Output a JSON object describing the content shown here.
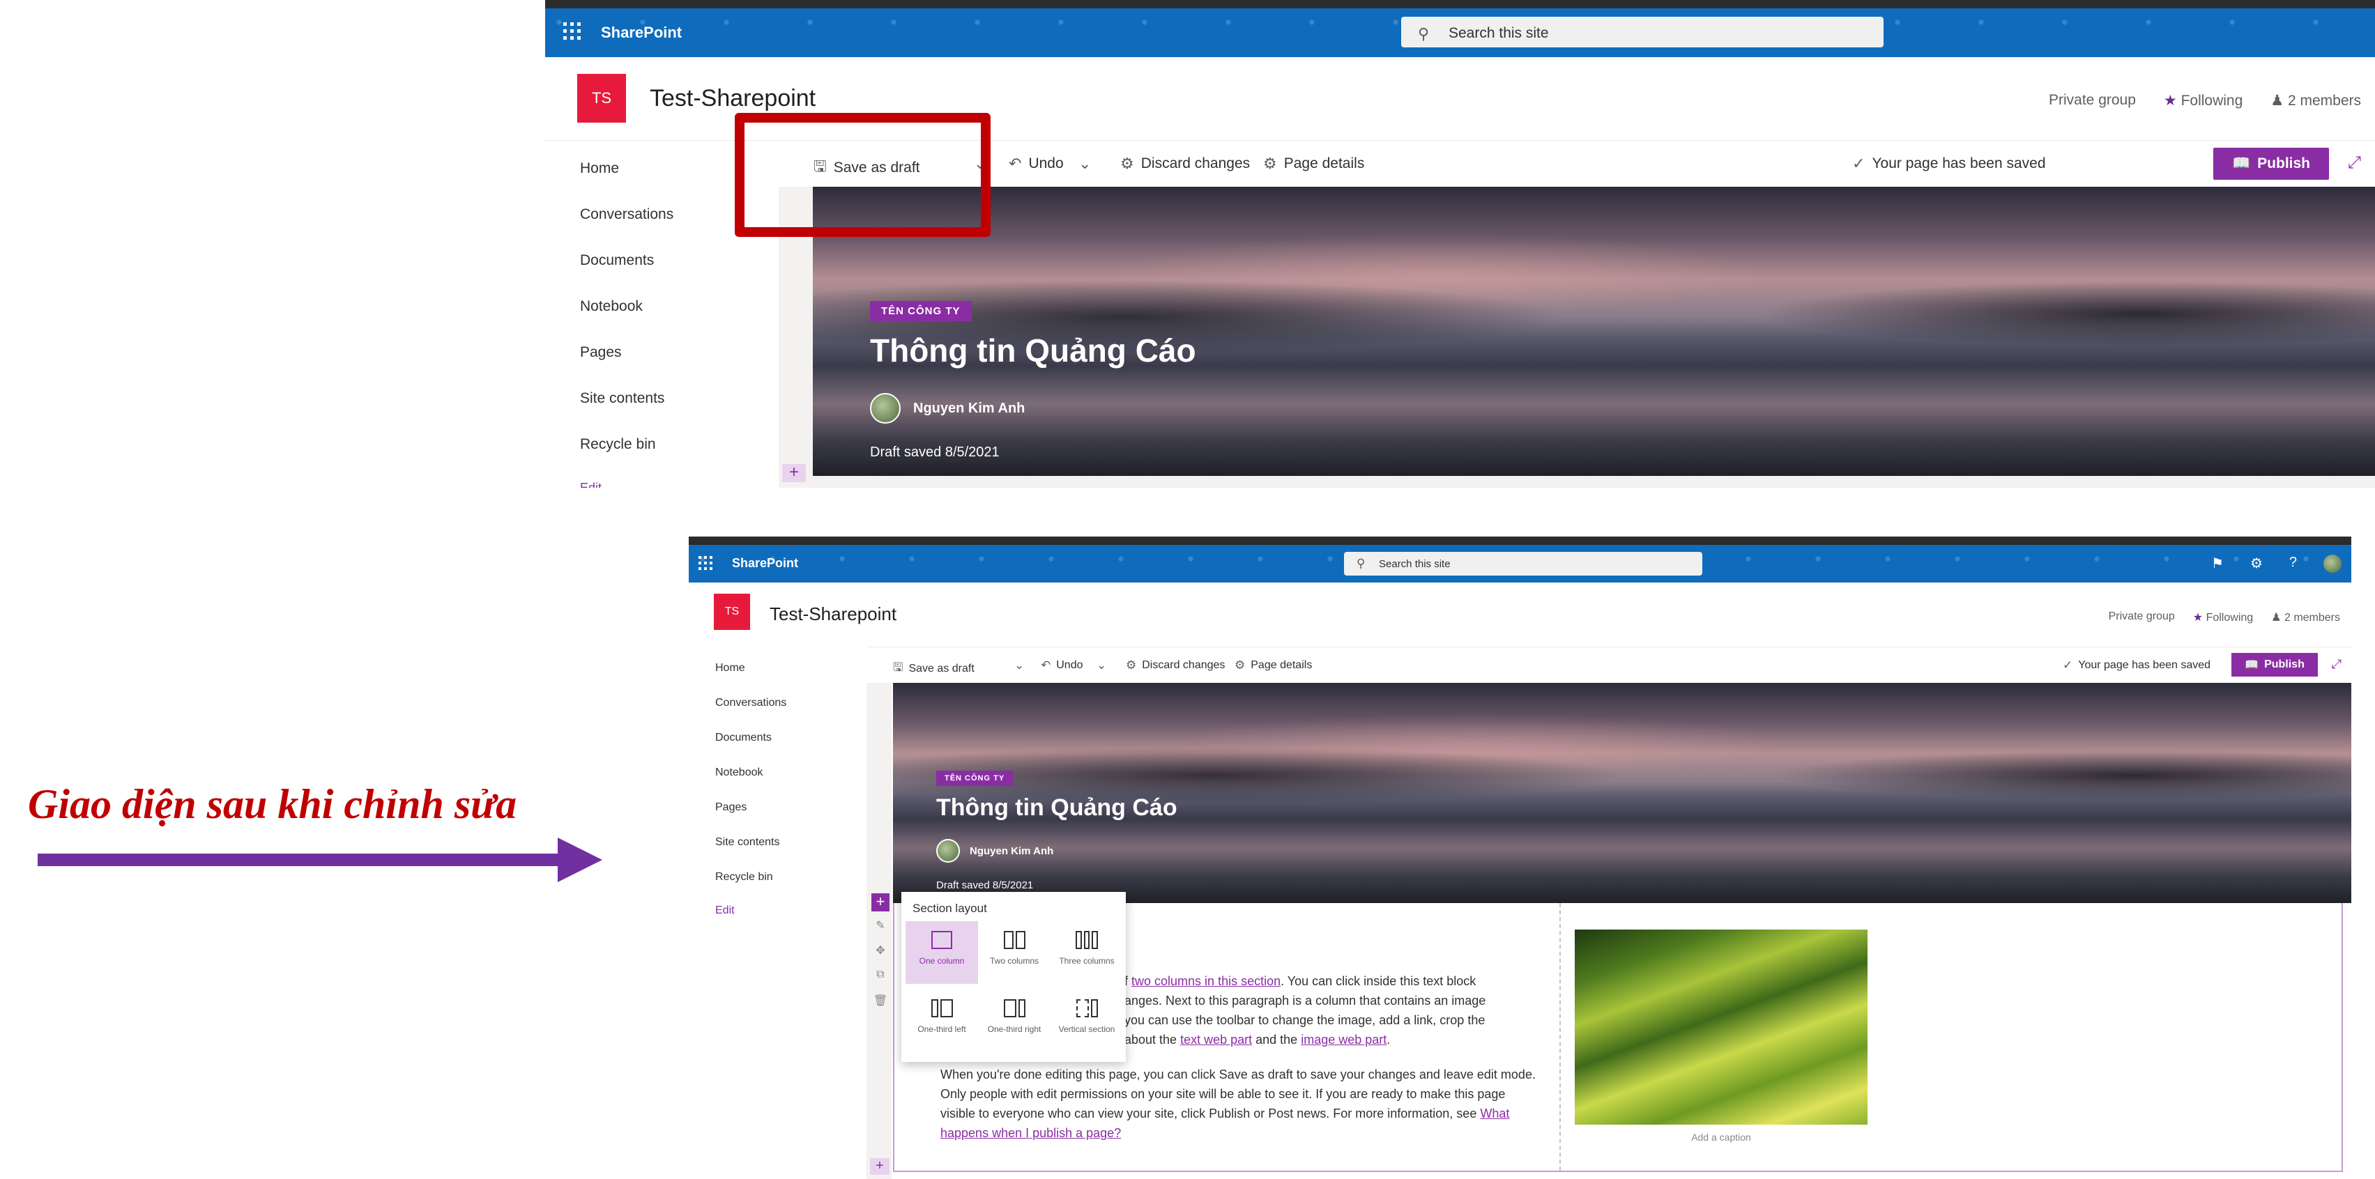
{
  "app": {
    "name": "SharePoint"
  },
  "search": {
    "placeholder": "Search this site"
  },
  "site": {
    "logo_text": "TS",
    "title": "Test-Sharepoint",
    "privacy": "Private group",
    "following": "Following",
    "members": "2 members"
  },
  "nav": {
    "items": [
      "Home",
      "Conversations",
      "Documents",
      "Notebook",
      "Pages",
      "Site contents",
      "Recycle bin"
    ],
    "edit": "Edit"
  },
  "commandbar": {
    "save_draft": "Save as draft",
    "undo": "Undo",
    "discard": "Discard changes",
    "page_details": "Page details",
    "status": "Your page has been saved",
    "publish": "Publish"
  },
  "hero": {
    "tag": "TÊN CÔNG TY",
    "title": "Thông tin Quảng Cáo",
    "author": "Nguyen Kim Anh",
    "draft_status": "Draft saved 8/5/2021"
  },
  "annotation": {
    "text": "Giao diện sau khi chỉnh sửa"
  },
  "section_layout": {
    "title": "Section layout",
    "options": [
      "One column",
      "Two columns",
      "Three columns",
      "One-third left",
      "One-third right",
      "Vertical section"
    ]
  },
  "body": {
    "p1_a": "f ",
    "p1_link1": "two columns in this section",
    "p1_b": ". You can click inside this text block",
    "p1_c": "anges. Next to this paragraph is a column that contains an image",
    "p1_d": "you can use the toolbar to change the image, add a link, crop the",
    "p1_e": "about the ",
    "p1_link2": "text web part",
    "p1_f": " and the ",
    "p1_link3": "image web part",
    "p1_g": ".",
    "p2": "When you're done editing this page, you can click Save as draft to save your changes and leave edit mode. Only people with edit permissions on your site will be able to see it. If you are ready to make this page visible to everyone who can view your site, click Publish or Post news. For more information, see ",
    "p2_link": "What happens when I publish a page?",
    "caption": "Add a caption"
  },
  "colors": {
    "suite_bar": "#0f6cbd",
    "accent": "#8a2da5",
    "logo": "#e81a3b",
    "highlight": "#c00000",
    "arrow": "#7030a0"
  }
}
